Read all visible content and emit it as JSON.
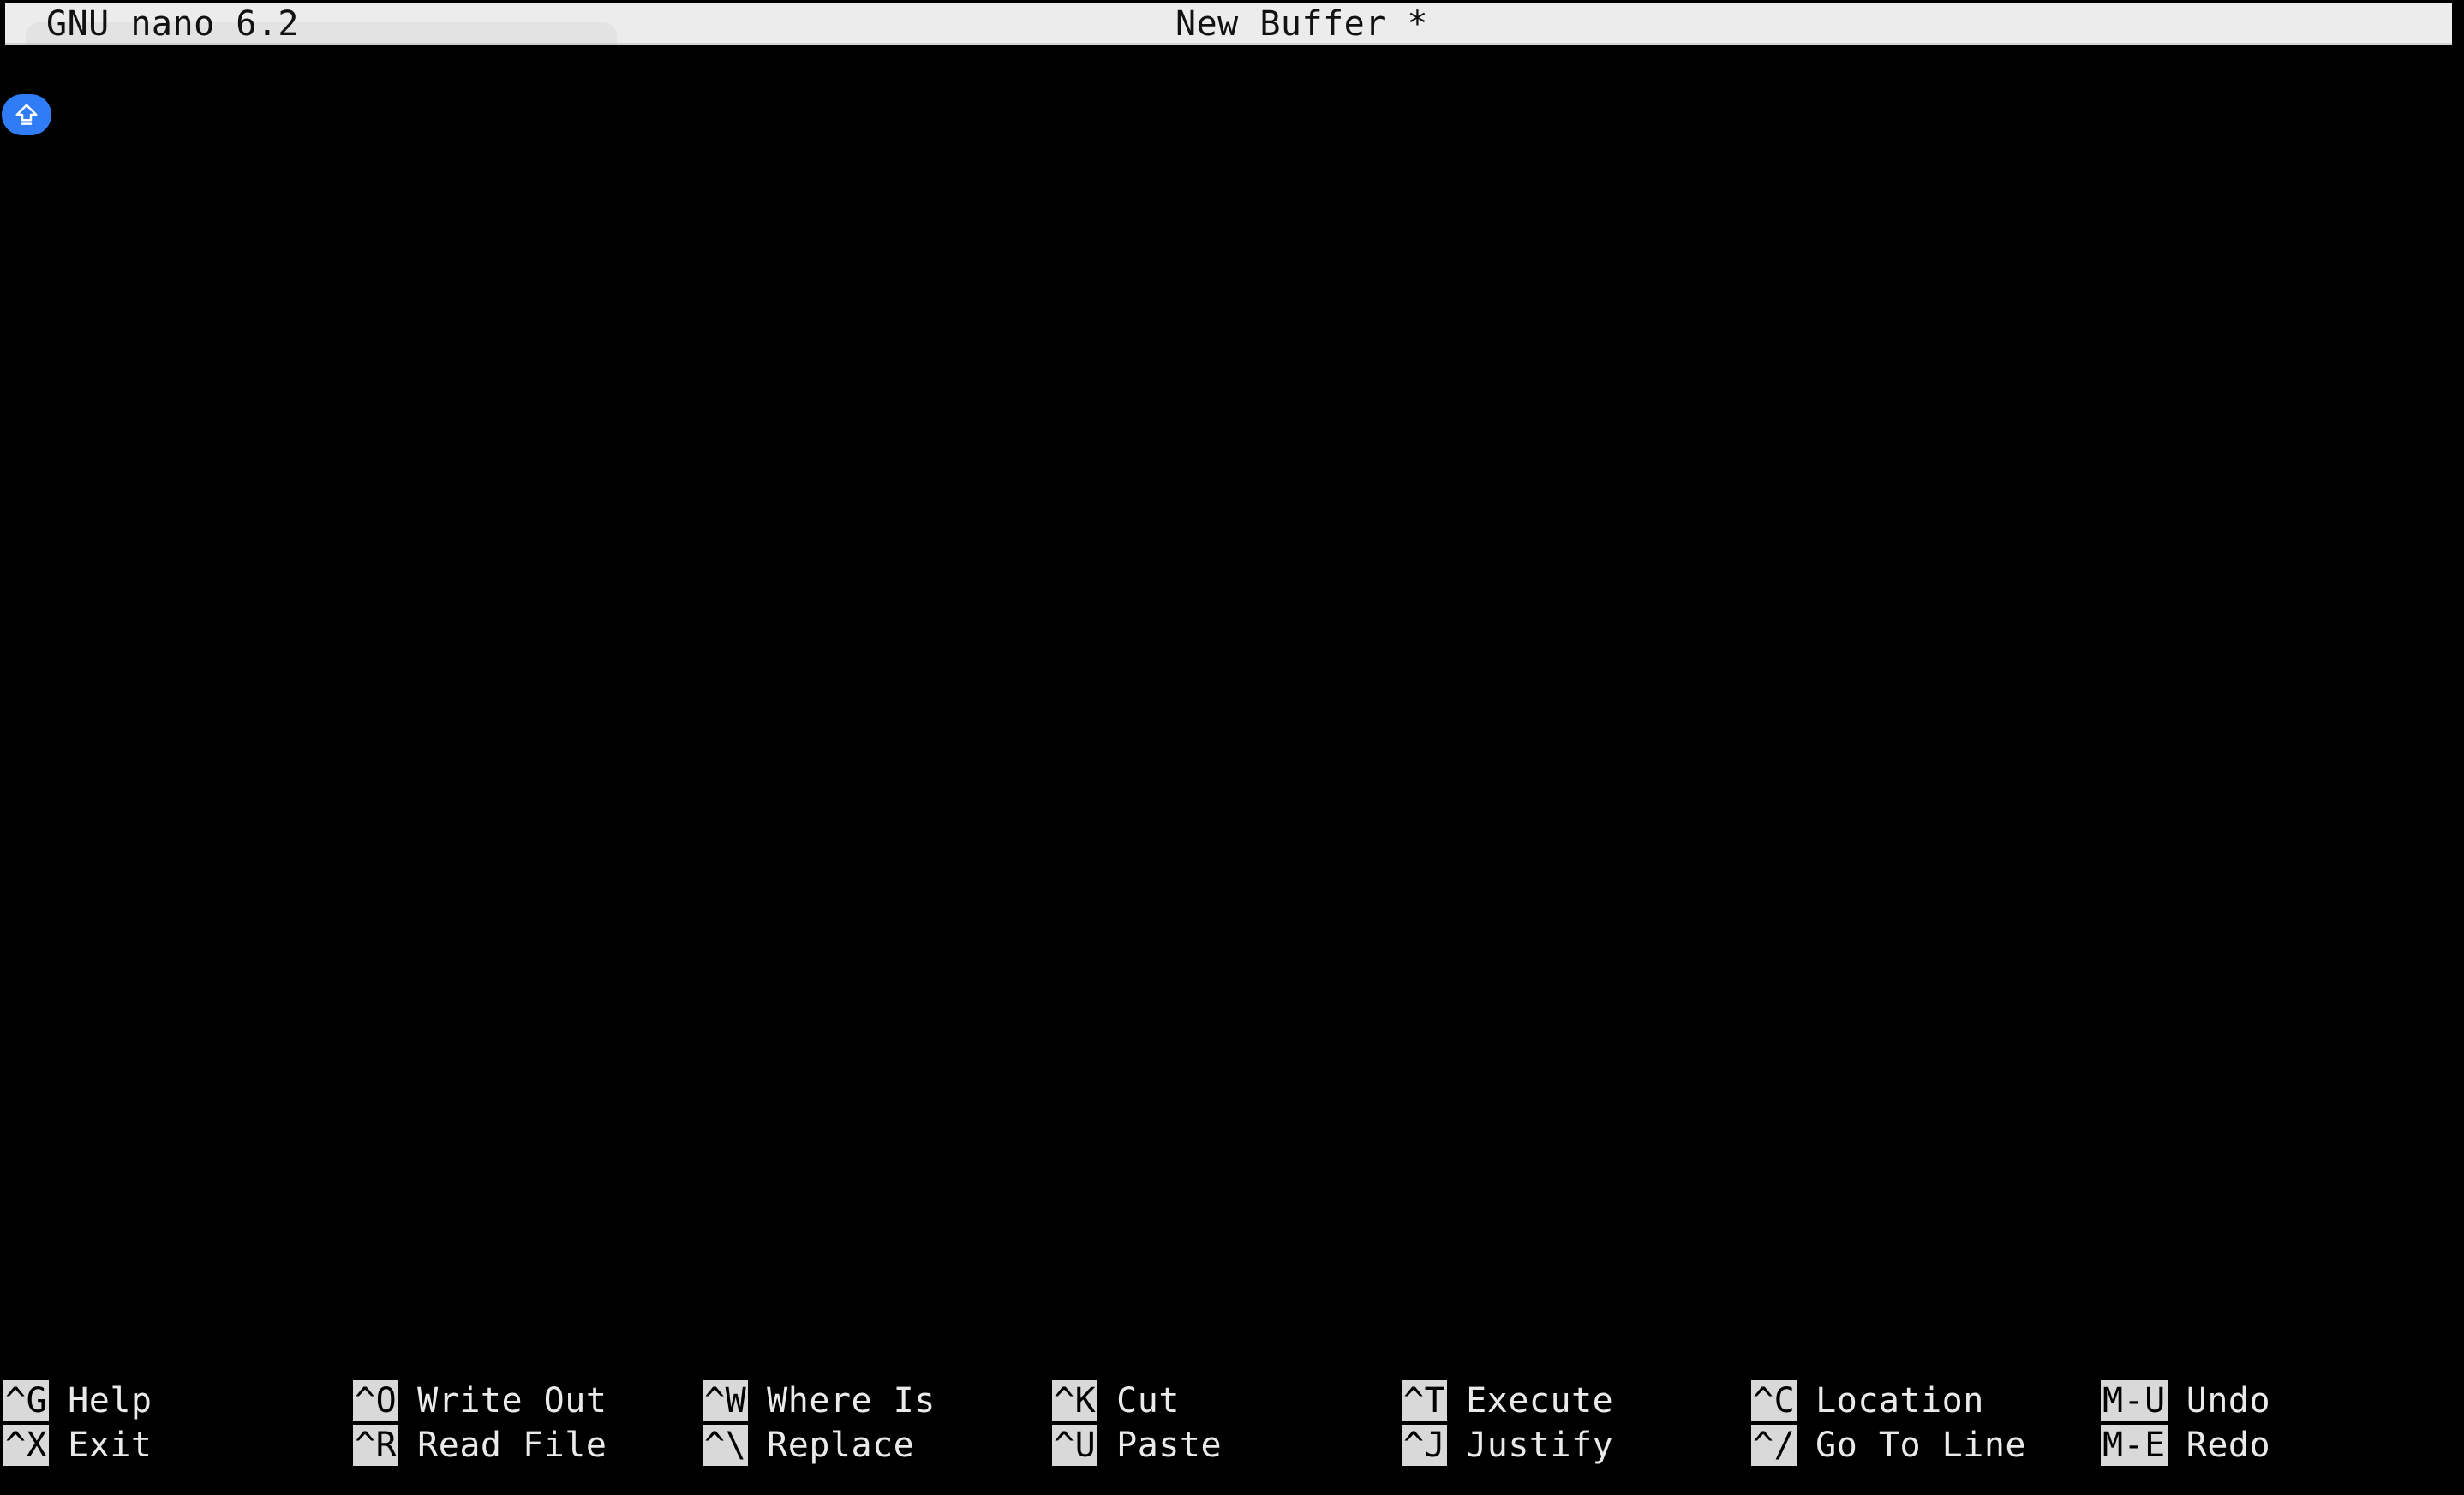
{
  "titlebar": {
    "app_version": "GNU nano 6.2",
    "buffer_name": "New Buffer *"
  },
  "badge": {
    "icon": "shift-arrow-up-icon",
    "color": "#2f7cf6"
  },
  "shortcuts": {
    "row1": [
      {
        "key": "^G",
        "label": "Help"
      },
      {
        "key": "^O",
        "label": "Write Out"
      },
      {
        "key": "^W",
        "label": "Where Is"
      },
      {
        "key": "^K",
        "label": "Cut"
      },
      {
        "key": "^T",
        "label": "Execute"
      },
      {
        "key": "^C",
        "label": "Location"
      },
      {
        "key": "M-U",
        "label": "Undo"
      }
    ],
    "row2": [
      {
        "key": "^X",
        "label": "Exit"
      },
      {
        "key": "^R",
        "label": "Read File"
      },
      {
        "key": "^\\",
        "label": "Replace"
      },
      {
        "key": "^U",
        "label": "Paste"
      },
      {
        "key": "^J",
        "label": "Justify"
      },
      {
        "key": "^/",
        "label": "Go To Line"
      },
      {
        "key": "M-E",
        "label": "Redo"
      }
    ]
  }
}
